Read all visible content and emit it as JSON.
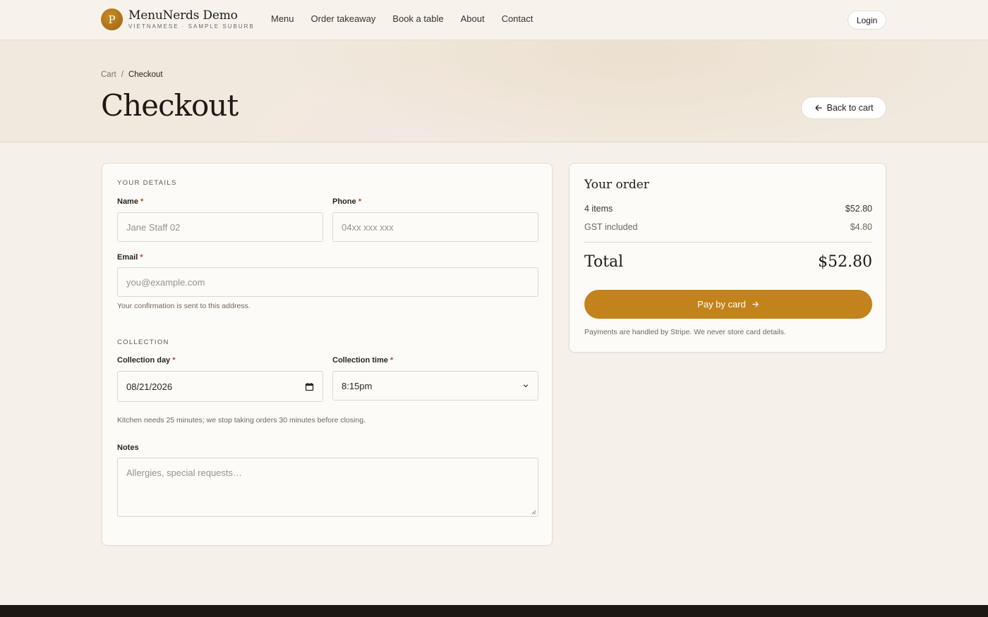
{
  "brand": {
    "logo_letter": "P",
    "name": "MenuNerds Demo",
    "subtitle": "VIETNAMESE · SAMPLE SUBURB"
  },
  "nav": {
    "items": [
      "Menu",
      "Order takeaway",
      "Book a table",
      "About",
      "Contact"
    ],
    "login_label": "Login"
  },
  "breadcrumb": {
    "parent": "Cart",
    "separator": "/",
    "current": "Checkout"
  },
  "page_title": "Checkout",
  "back_button_label": "Back to cart",
  "form": {
    "details_heading": "YOUR DETAILS",
    "name": {
      "label": "Name",
      "required": "*",
      "value": "Jane Staff 02"
    },
    "phone": {
      "label": "Phone",
      "required": "*",
      "placeholder": "04xx xxx xxx"
    },
    "email": {
      "label": "Email",
      "required": "*",
      "placeholder": "you@example.com",
      "hint": "Your confirmation is sent to this address."
    },
    "collection_heading": "COLLECTION",
    "collection_day": {
      "label": "Collection day",
      "required": "*",
      "value": "08/21/2026"
    },
    "collection_time": {
      "label": "Collection time",
      "required": "*",
      "value": "8:15pm"
    },
    "collection_hint": "Kitchen needs 25 minutes; we stop taking orders 30 minutes before closing.",
    "notes": {
      "label": "Notes",
      "placeholder": "Allergies, special requests…"
    }
  },
  "order": {
    "title": "Your order",
    "items_label": "4 items",
    "items_amount": "$52.80",
    "gst_label": "GST included",
    "gst_amount": "$4.80",
    "total_label": "Total",
    "total_amount": "$52.80",
    "pay_label": "Pay by card",
    "pay_note": "Payments are handled by Stripe. We never store card details."
  },
  "colors": {
    "accent": "#c2821c",
    "background": "#f5f1ea",
    "card": "#fdfbf7",
    "footer": "#1d1814",
    "required": "#b34a2c"
  },
  "icons": [
    "arrow-left-icon",
    "arrow-right-icon",
    "calendar-icon",
    "chevron-down-icon"
  ]
}
